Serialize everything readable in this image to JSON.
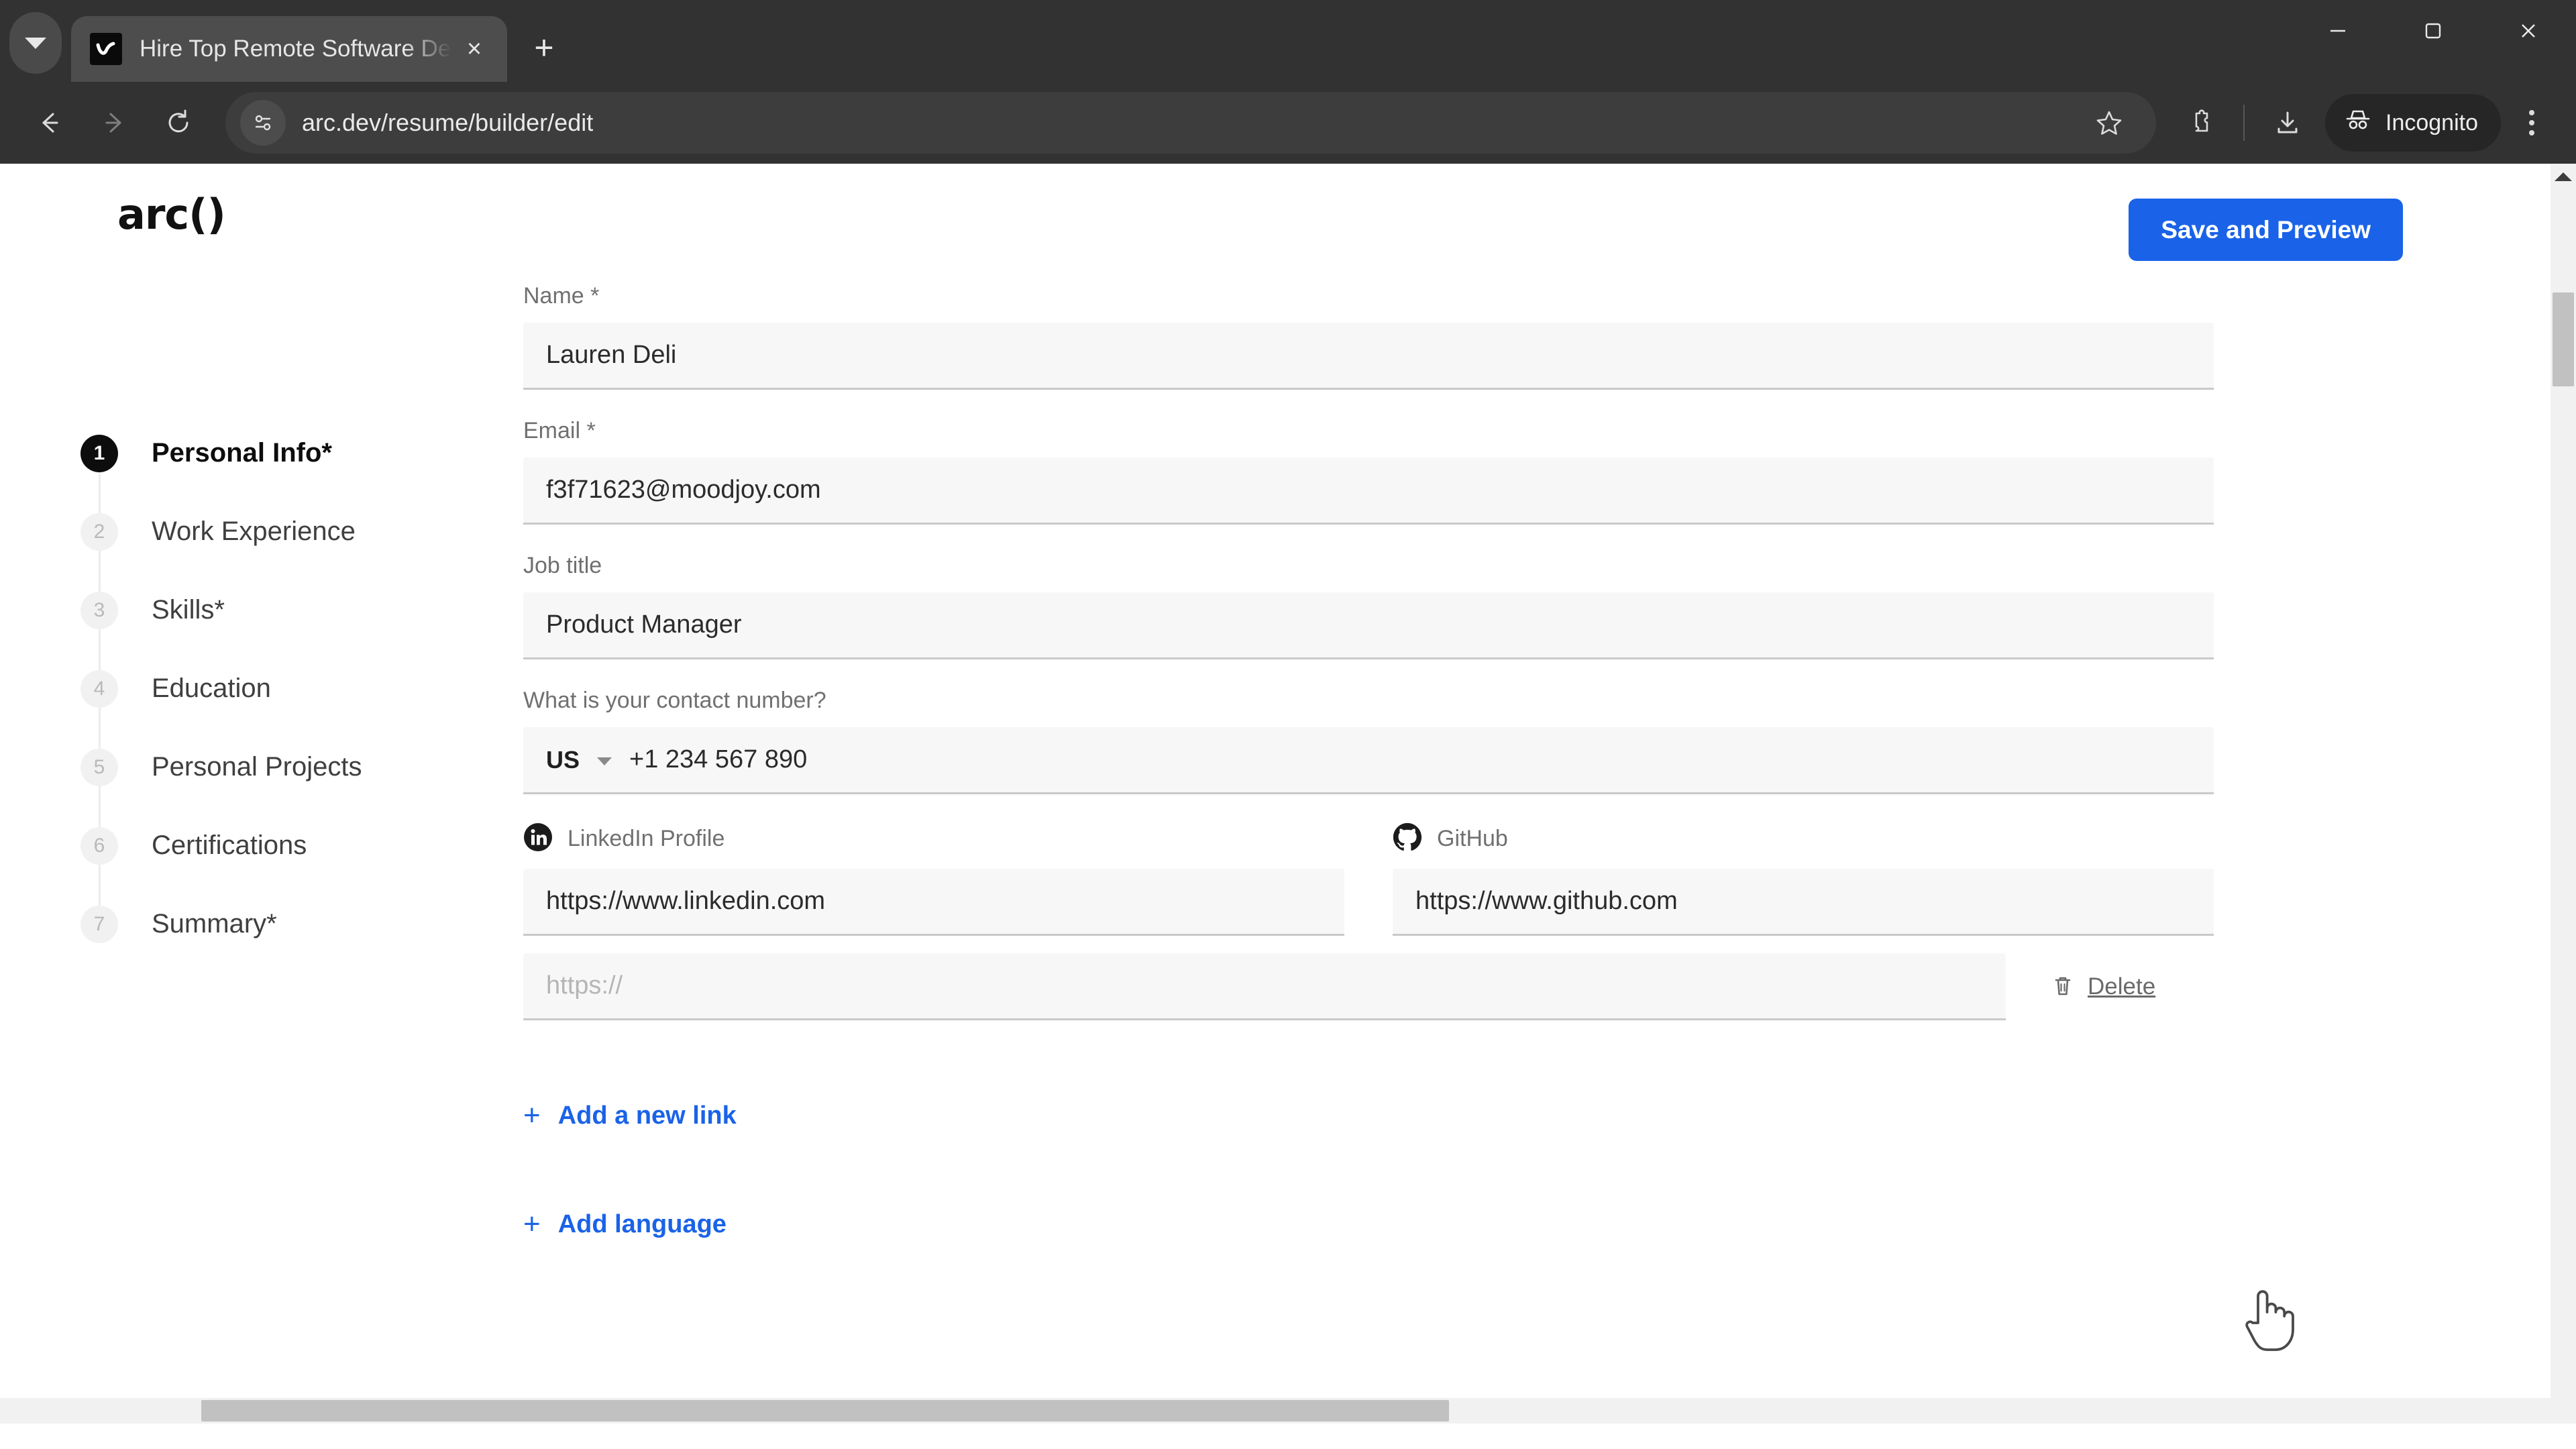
{
  "browser": {
    "tab": {
      "title": "Hire Top Remote Software Deve",
      "favicon_name": "arc-logo-favicon",
      "close_label": "×"
    },
    "new_tab_label": "+",
    "tab_list_icon": "chevron-down-icon",
    "window_controls": {
      "minimize": "minimize-icon",
      "maximize": "maximize-icon",
      "close": "close-icon"
    },
    "toolbar": {
      "back": "back-arrow-icon",
      "forward": "forward-arrow-icon",
      "reload": "reload-icon",
      "site_info_icon": "site-settings-icon",
      "url": "arc.dev/resume/builder/edit",
      "bookmark_icon": "star-icon",
      "extensions_icon": "puzzle-piece-icon",
      "downloads_icon": "download-icon",
      "profile_label": "Incognito",
      "profile_icon": "incognito-hat-icon",
      "menu_icon": "kebab-menu-icon"
    }
  },
  "header": {
    "logo": "arc()",
    "save_button": "Save and Preview"
  },
  "stepper": {
    "items": [
      {
        "number": "1",
        "label": "Personal Info*",
        "active": true
      },
      {
        "number": "2",
        "label": "Work Experience",
        "active": false
      },
      {
        "number": "3",
        "label": "Skills*",
        "active": false
      },
      {
        "number": "4",
        "label": "Education",
        "active": false
      },
      {
        "number": "5",
        "label": "Personal Projects",
        "active": false
      },
      {
        "number": "6",
        "label": "Certifications",
        "active": false
      },
      {
        "number": "7",
        "label": "Summary*",
        "active": false
      }
    ]
  },
  "form": {
    "name": {
      "label": "Name *",
      "value": "Lauren Deli"
    },
    "email": {
      "label": "Email *",
      "value": "f3f71623@moodjoy.com"
    },
    "job_title": {
      "label": "Job title",
      "value": "Product Manager"
    },
    "contact_number": {
      "label": "What is your contact number?",
      "country_code": "US",
      "value": "+1 234 567 890"
    },
    "linkedin": {
      "label": "LinkedIn Profile",
      "icon": "linkedin-icon",
      "value": "https://www.linkedin.com"
    },
    "github": {
      "label": "GitHub",
      "icon": "github-icon",
      "value": "https://www.github.com"
    },
    "extra_link": {
      "placeholder": "https://",
      "value": "",
      "delete_label": "Delete",
      "delete_icon": "trash-icon"
    },
    "add_link_button": {
      "icon": "plus-icon",
      "label": "Add a new link"
    },
    "add_language_button": {
      "icon": "plus-icon",
      "label": "Add language"
    }
  },
  "colors": {
    "accent_blue": "#1a63e8",
    "input_bg": "#f7f7f8",
    "input_underline": "#c9c9c9",
    "active_step": "#0d0d0d"
  }
}
